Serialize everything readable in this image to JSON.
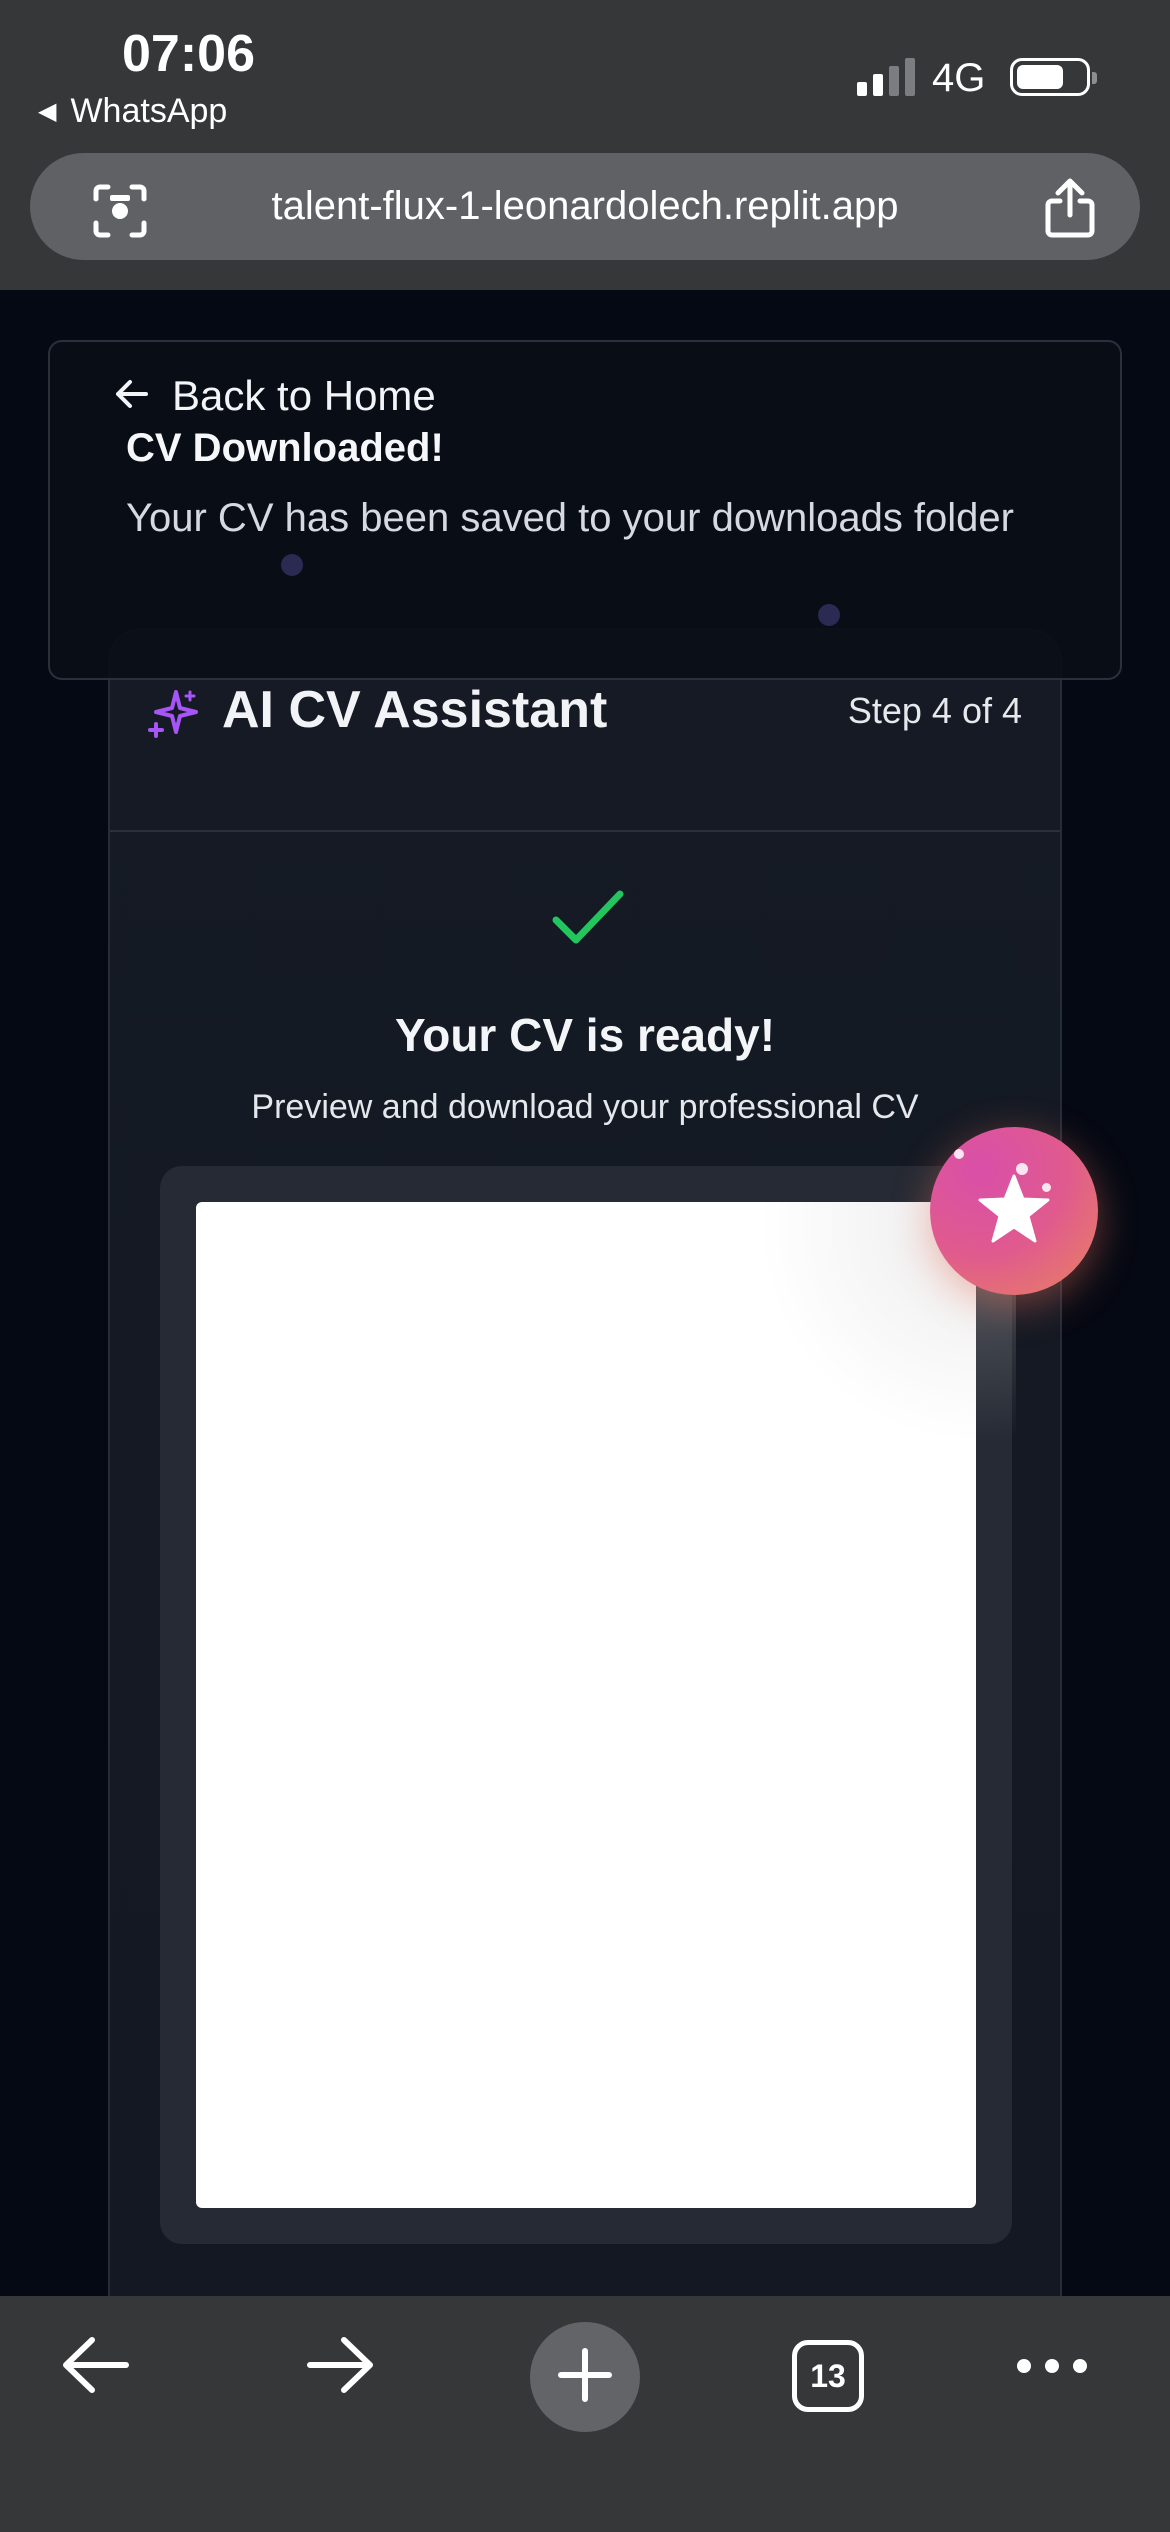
{
  "status_bar": {
    "time": "07:06",
    "back_app": "WhatsApp",
    "network": "4G"
  },
  "browser": {
    "url": "talent-flux-1-leonardolech.replit.app",
    "tab_count": "13"
  },
  "toast": {
    "back_link": "Back to Home",
    "title": "CV Downloaded!",
    "message": "Your CV has been saved to your downloads folder"
  },
  "assistant": {
    "title": "AI CV Assistant",
    "step": "Step 4 of 4",
    "ready_title": "Your CV is ready!",
    "ready_subtitle": "Preview and download your professional CV"
  },
  "colors": {
    "accent_purple": "#a855f7",
    "success_green": "#22c55e",
    "fab_pink": "#e05a8e",
    "fab_orange": "#e8845e"
  },
  "icons": [
    "lens-scan-icon",
    "share-icon",
    "arrow-left-icon",
    "sparkles-icon",
    "checkmark-icon",
    "star-icon",
    "back-arrow-icon",
    "forward-arrow-icon",
    "plus-icon",
    "tabs-icon",
    "more-icon"
  ]
}
